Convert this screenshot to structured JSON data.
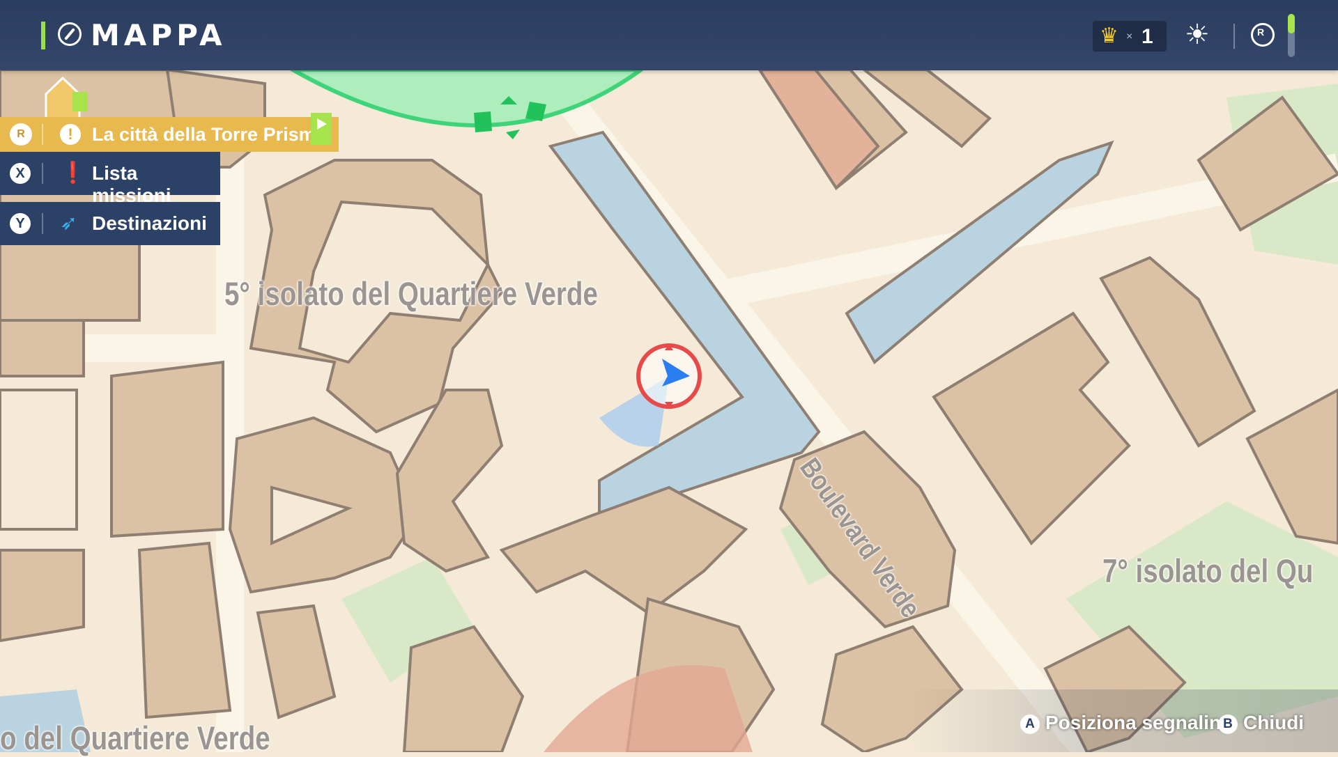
{
  "header": {
    "title": "MAPPA",
    "crown_multiplier": "×",
    "crown_count": "1",
    "icons": [
      "compass-icon",
      "crown-icon",
      "sun-icon",
      "radar-icon",
      "battery-icon"
    ],
    "accent_color": "#9be04a"
  },
  "menu": {
    "active_quest": {
      "key": "R",
      "label": "La città della Torre Prisma",
      "color": "#e8b94f"
    },
    "items": [
      {
        "key": "X",
        "label": "Lista missioni",
        "icon": "quest-list-icon"
      },
      {
        "key": "Y",
        "label": "Destinazioni",
        "icon": "feather-icon"
      }
    ]
  },
  "map": {
    "labels": {
      "district_5": "5° isolato del Quartiere Verde",
      "district_7": "7° isolato del Qu",
      "district_bottom": "o del Quartiere Verde",
      "boulevard": "Boulevard Verde"
    },
    "colors": {
      "ground": "#f4ead7",
      "building": "#dcc2a4",
      "building_outline": "#8e7f72",
      "water": "#b9d3e0",
      "park": "#d9e8c6",
      "zone": "#5fe08a",
      "player_ring": "#e84a4a",
      "player_arrow": "#2a7ef0"
    }
  },
  "footer": {
    "place_marker": {
      "key": "A",
      "label": "Posiziona segnalino"
    },
    "close": {
      "key": "B",
      "label": "Chiudi"
    }
  }
}
